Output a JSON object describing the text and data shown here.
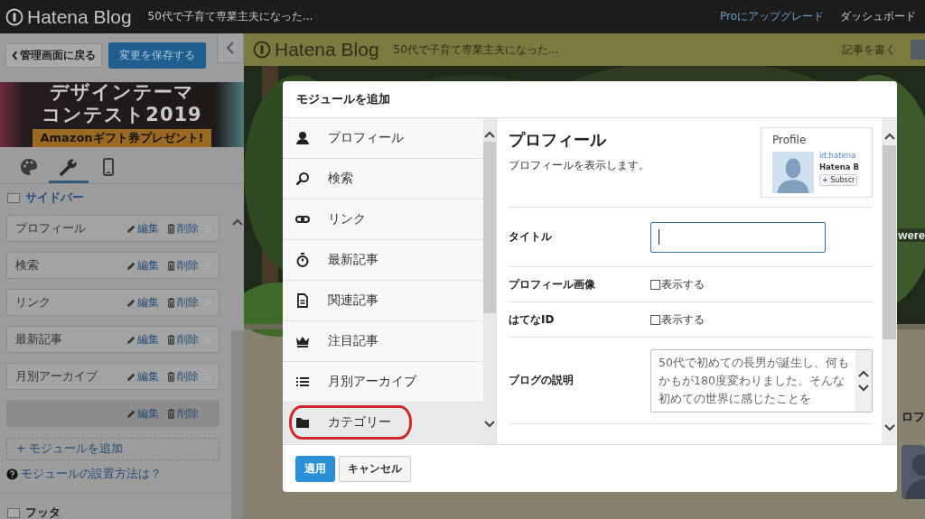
{
  "top_bar": {
    "logo": "Hatena Blog",
    "blog_title": "50代で子育て専業主夫になった...",
    "links": [
      "Proにアップグレード",
      "ダッシュボード"
    ]
  },
  "editor": {
    "back_button": "管理画面に戻る",
    "save_button": "変更を保存する",
    "banner": {
      "title_line_1": "デザインテーマ",
      "title_line_2": "コンテスト2019",
      "ribbon": "Amazonギフト券プレゼント!"
    },
    "tabs": [
      {
        "kind": "design",
        "selected": false
      },
      {
        "kind": "customize",
        "selected": true
      },
      {
        "kind": "smartphone",
        "selected": false
      }
    ],
    "section_title": "サイドバー",
    "modules": [
      {
        "name": "プロフィール",
        "edit": "編集",
        "delete": "削除",
        "dragging": false
      },
      {
        "name": "検索",
        "edit": "編集",
        "delete": "削除",
        "dragging": false
      },
      {
        "name": "リンク",
        "edit": "編集",
        "delete": "削除",
        "dragging": false
      },
      {
        "name": "最新記事",
        "edit": "編集",
        "delete": "削除",
        "dragging": false
      },
      {
        "name": "月別アーカイブ",
        "edit": "編集",
        "delete": "削除",
        "dragging": false
      },
      {
        "edit": "編集",
        "delete": "削除",
        "dragging": true
      }
    ],
    "add_module": "+ モジュールを追加",
    "help_link": "モジュールの設置方法は？",
    "footer_section": "フッタ"
  },
  "blog_preview": {
    "logo": "Hatena Blog",
    "blog_title": "50代で子育て専業主夫になった...",
    "write_link": "記事を書く",
    "peek_texts": [
      "were",
      "ロフ"
    ]
  },
  "modal": {
    "title": "モジュールを追加",
    "modules": [
      {
        "kind": "profile",
        "label": "プロフィール",
        "selected": false,
        "circled": false
      },
      {
        "kind": "search",
        "label": "検索",
        "selected": false,
        "circled": false
      },
      {
        "kind": "link",
        "label": "リンク",
        "selected": false,
        "circled": false
      },
      {
        "kind": "recent",
        "label": "最新記事",
        "selected": false,
        "circled": false
      },
      {
        "kind": "related",
        "label": "関連記事",
        "selected": false,
        "circled": false
      },
      {
        "kind": "featured",
        "label": "注目記事",
        "selected": false,
        "circled": false
      },
      {
        "kind": "archive",
        "label": "月別アーカイブ",
        "selected": false,
        "circled": false
      },
      {
        "kind": "category",
        "label": "カテゴリー",
        "selected": true,
        "circled": true
      }
    ],
    "detail": {
      "title": "プロフィール",
      "description": "プロフィールを表示します。",
      "preview": {
        "heading": "Profile",
        "id": "id:hatena",
        "name": "Hatena B",
        "subscribe": "+ Subscr"
      },
      "fields": [
        {
          "kind": "text",
          "label": "タイトル"
        },
        {
          "kind": "checkbox",
          "label": "プロフィール画像",
          "option": "表示する",
          "checked": false
        },
        {
          "kind": "checkbox",
          "label": "はてなID",
          "option": "表示する",
          "checked": false
        },
        {
          "kind": "textarea",
          "label": "ブログの説明",
          "value": "50代で初めての長男が誕生し、何もかもが180度変わりました。そんな初めての世界に感じたことを"
        }
      ]
    },
    "buttons": [
      {
        "kind": "primary",
        "label": "適用"
      },
      {
        "kind": "default",
        "label": "キャンセル"
      }
    ]
  }
}
